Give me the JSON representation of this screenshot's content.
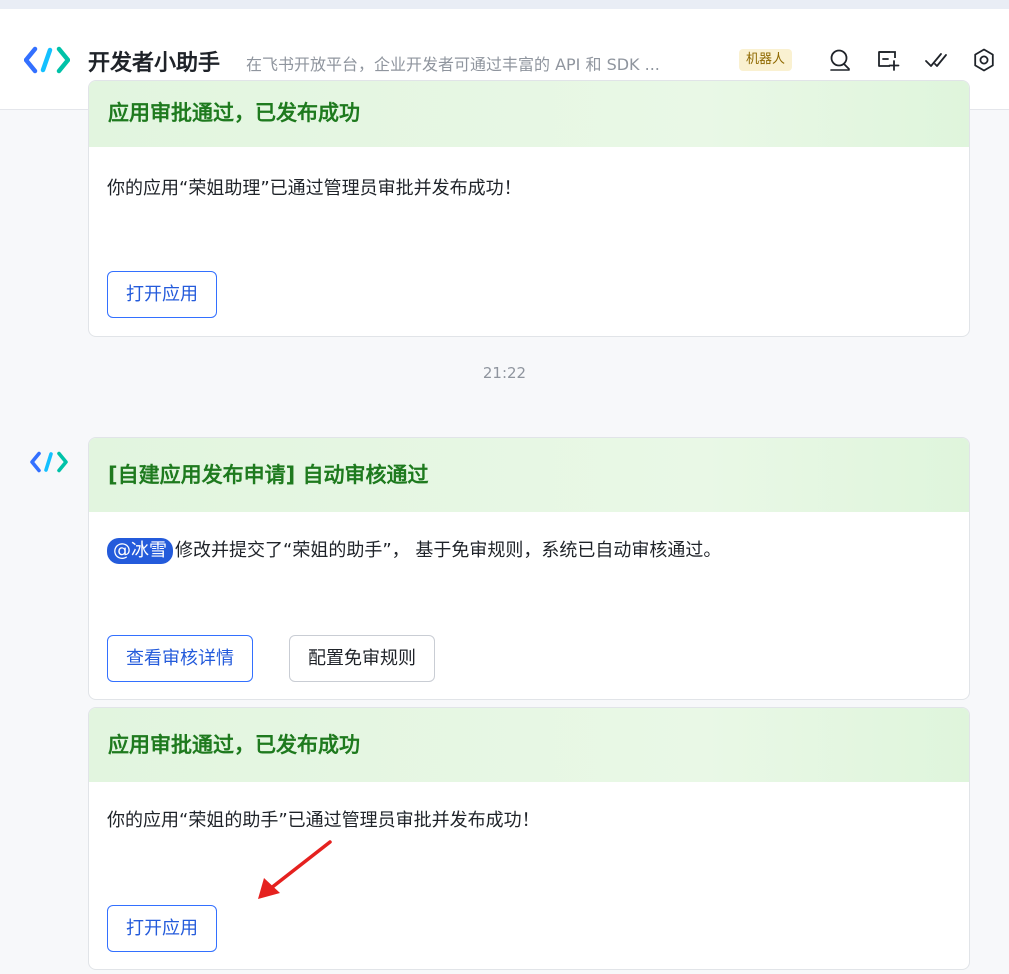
{
  "header": {
    "title": "开发者小助手",
    "subtitle": "在飞书开放平台，企业开发者可通过丰富的 API 和 SDK ...",
    "badge": "机器人",
    "icons": [
      "search-icon",
      "add-chat-icon",
      "check-icon",
      "settings-icon"
    ]
  },
  "messages": [
    {
      "header": "应用审批通过，已发布成功",
      "text": "你的应用“荣姐助理”已通过管理员审批并发布成功！",
      "buttons": [
        "打开应用"
      ]
    },
    {
      "timestamp": "21:22"
    },
    {
      "header": "[自建应用发布申请] 自动审核通过",
      "mention": "@冰雪",
      "text": "修改并提交了“荣姐的助手”， 基于免审规则，系统已自动审核通过。",
      "buttons": [
        "查看审核详情",
        "配置免审规则"
      ]
    },
    {
      "header": "应用审批通过，已发布成功",
      "text": "你的应用“荣姐的助手”已通过管理员审批并发布成功！",
      "buttons": [
        "打开应用"
      ]
    }
  ],
  "colors": {
    "accent": "#3370ff",
    "card_header_text": "#1e7a1e",
    "card_header_bg": "#e2f5df",
    "mention_bg": "#245bdb",
    "annotation_arrow": "#e5211f"
  }
}
